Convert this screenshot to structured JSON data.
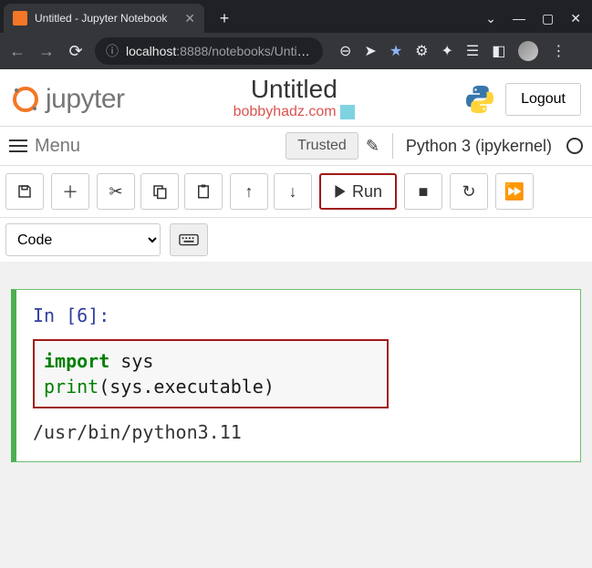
{
  "browser": {
    "tab_title": "Untitled - Jupyter Notebook",
    "url_host": "localhost",
    "url_port_path": ":8888/notebooks/Untit…"
  },
  "header": {
    "logo_text": "jupyter",
    "title": "Untitled",
    "subtitle": "bobbyhadz.com",
    "logout": "Logout"
  },
  "menubar": {
    "menu": "Menu",
    "trusted": "Trusted",
    "kernel": "Python 3 (ipykernel)"
  },
  "toolbar": {
    "run": "Run",
    "cell_type": "Code"
  },
  "cell": {
    "prompt": "In [6]:",
    "code": {
      "line1_kw": "import",
      "line1_rest": " sys",
      "line2_fn": "print",
      "line2_open": "(",
      "line2_arg": "sys.executable",
      "line2_close": ")"
    },
    "output": "/usr/bin/python3.11"
  }
}
